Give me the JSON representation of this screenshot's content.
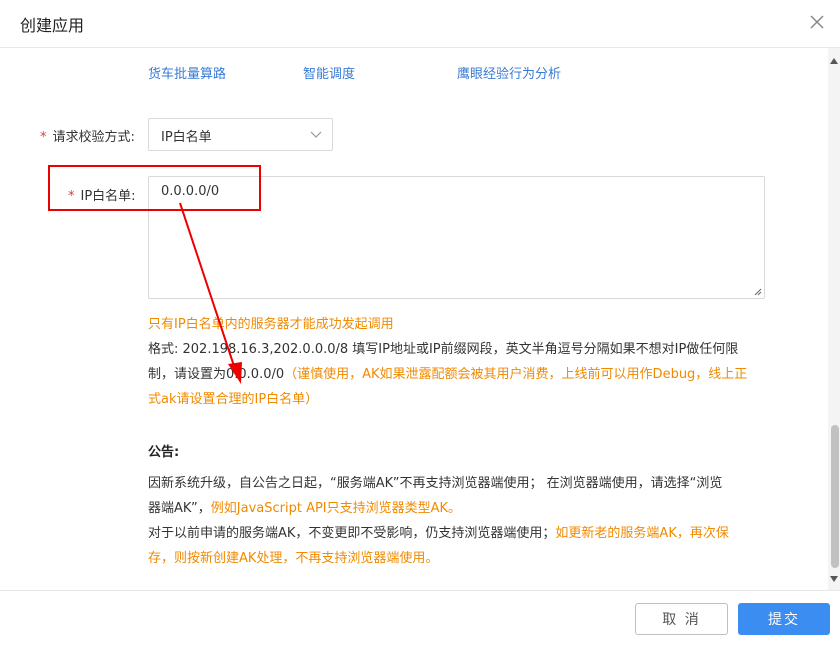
{
  "dialog": {
    "title": "创建应用"
  },
  "services": {
    "links": [
      "货车批量算路",
      "智能调度",
      "鹰眼经验行为分析"
    ]
  },
  "form": {
    "verify_method": {
      "required_mark": "*",
      "label": "请求校验方式:",
      "value": "IP白名单"
    },
    "ip_whitelist": {
      "required_mark": "*",
      "label": "IP白名单:",
      "value": "0.0.0.0/0"
    }
  },
  "help": {
    "warning": "只有IP白名单内的服务器才能成功发起调用",
    "format_line1": "格式: 202.198.16.3,202.0.0.0/8 填写IP地址或IP前缀网段，英文半角逗号分隔如果不想对IP做任何限",
    "format_line2_prefix": "制，请设置为0.0.0.0/0",
    "format_line2_orange": "（谨慎使用，AK如果泄露配额会被其用户消费，上线前可以用作Debug，线上正",
    "format_line3_orange": "式ak请设置合理的IP白名单）"
  },
  "notice": {
    "title": "公告:",
    "p1_line1": "因新系统升级，自公告之日起，“服务端AK”不再支持浏览器端使用； 在浏览器端使用，请选择“浏览",
    "p1_line2_prefix": "器端AK”，",
    "p1_line2_orange": "例如JavaScript API只支持浏览器类型AK。",
    "p2_line1_prefix": "对于以前申请的服务端AK，不变更即不受影响，仍支持浏览器端使用；",
    "p2_line1_orange": "如更新老的服务端AK，再次保",
    "p2_line2_orange": "存，则按新创建AK处理，不再支持浏览器端使用。"
  },
  "footer": {
    "cancel": "取 消",
    "submit": "提交"
  },
  "colors": {
    "link": "#3a7bd5",
    "warning": "#f08a00",
    "primary": "#3b8df2",
    "required": "#e33",
    "annotation": "#e00"
  },
  "icons": {
    "close": "close-icon",
    "select": "chevron-down-icon",
    "resize": "resize-handle-icon"
  }
}
